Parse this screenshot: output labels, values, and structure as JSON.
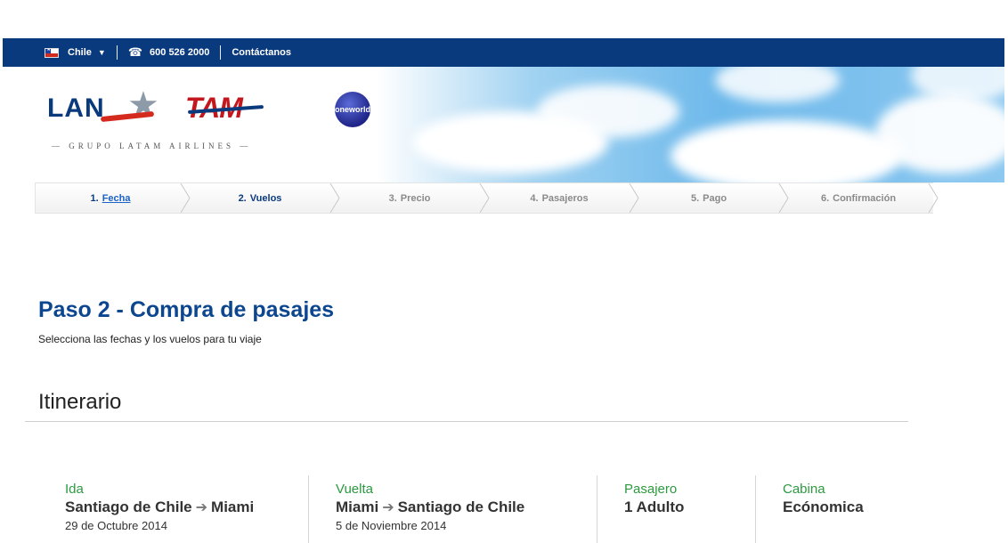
{
  "topbar": {
    "country": "Chile",
    "phone": "600 526 2000",
    "contact": "Contáctanos",
    "bg_color": "#0a3a7e"
  },
  "header": {
    "logo_lan": "LAN",
    "logo_tam": "TAM",
    "oneworld": "oneworld",
    "tagline": "— GRUPO LATAM AIRLINES —"
  },
  "steps": [
    {
      "num": "1.",
      "label": "Fecha",
      "state": "done"
    },
    {
      "num": "2.",
      "label": "Vuelos",
      "state": "active"
    },
    {
      "num": "3.",
      "label": "Precio",
      "state": "pending"
    },
    {
      "num": "4.",
      "label": "Pasajeros",
      "state": "pending"
    },
    {
      "num": "5.",
      "label": "Pago",
      "state": "pending"
    },
    {
      "num": "6.",
      "label": "Confirmación",
      "state": "pending"
    }
  ],
  "main": {
    "title": "Paso 2 - Compra de pasajes",
    "subtitle": "Selecciona las fechas y los vuelos para tu viaje",
    "section_title": "Itinerario"
  },
  "itinerary": {
    "ida": {
      "label": "Ida",
      "from": "Santiago de Chile",
      "to": "Miami",
      "date": "29 de Octubre 2014"
    },
    "vuelta": {
      "label": "Vuelta",
      "from": "Miami",
      "to": "Santiago de Chile",
      "date": "5 de Noviembre 2014"
    },
    "pasajero": {
      "label": "Pasajero",
      "value": "1 Adulto"
    },
    "cabina": {
      "label": "Cabina",
      "value": "Ecónomica"
    }
  },
  "colors": {
    "title_blue": "#0b468f",
    "label_green": "#2b9a3f",
    "link_blue": "#1a62c6"
  }
}
